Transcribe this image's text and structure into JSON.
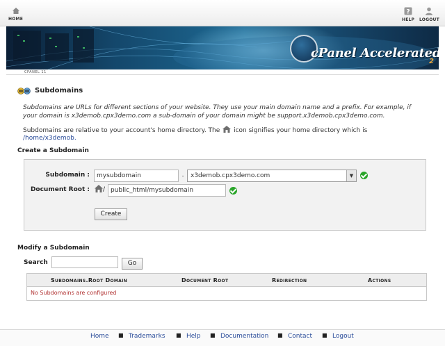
{
  "topbar": {
    "home_label": "HOME",
    "help_label": "HELP",
    "logout_label": "LOGOUT"
  },
  "banner": {
    "logo_text": "cPanel Accelerated",
    "logo_sub": "2"
  },
  "version_label": "CPANEL 11",
  "page": {
    "title": "Subdomains",
    "desc1_line1": "Subdomains are URLs for different sections of your website. They use your main domain name and a prefix. For example, if",
    "desc1_line2": "your domain is x3demob.cpx3demo.com a sub-domain of your domain might be support.x3demob.cpx3demo.com.",
    "desc2_line1_a": "Subdomains are relative to your account's home directory. The",
    "desc2_line1_b": "icon signifies your home directory which is",
    "home_path": "/home/x3demob."
  },
  "create": {
    "heading": "Create a Subdomain",
    "subdomain_label": "Subdomain :",
    "subdomain_value": "mysubdomain",
    "dot": ".",
    "domain_selected": "x3demob.cpx3demo.com",
    "docroot_label": "Document Root :",
    "docroot_prefix": "/",
    "docroot_value": "public_html/mysubdomain",
    "create_button": "Create"
  },
  "modify": {
    "heading": "Modify a Subdomain",
    "search_label": "Search",
    "search_value": "",
    "go_button": "Go",
    "columns": [
      "Subdomains.Root Domain",
      "Document Root",
      "Redirection",
      "Actions"
    ],
    "empty_message": "No Subdomains are configured"
  },
  "footer": {
    "links": [
      "Home",
      "Trademarks",
      "Help",
      "Documentation",
      "Contact",
      "Logout"
    ],
    "separator": "■"
  },
  "colors": {
    "link": "#2b4d9a",
    "error": "#b03030",
    "check": "#2aa52a"
  }
}
